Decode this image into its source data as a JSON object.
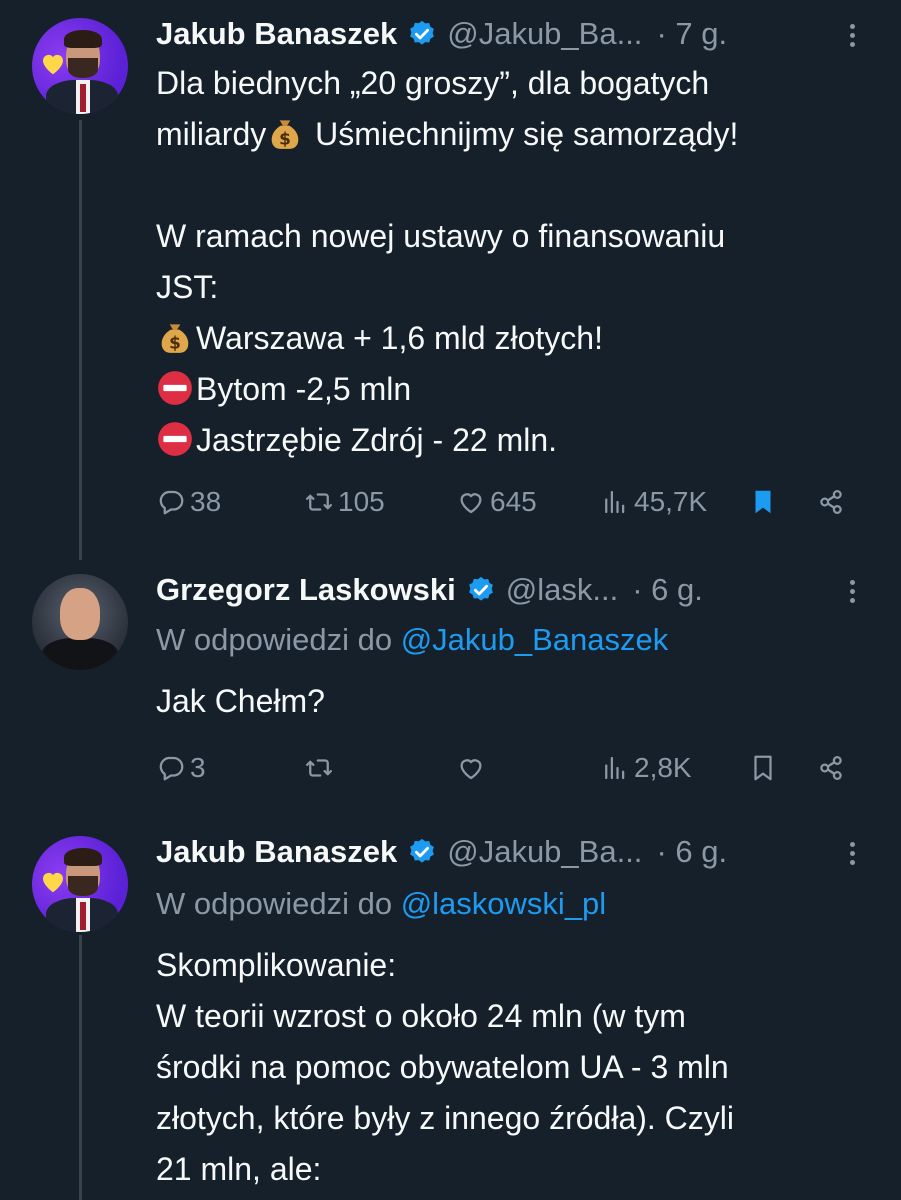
{
  "tweets": [
    {
      "author": "Jakub Banaszek",
      "handle": "@Jakub_Ba...",
      "time": "· 7 g.",
      "lines": [
        "Dla biednych „20 groszy”, dla bogatych",
        "miliardy",
        " Uśmiechnijmy się samorządy!",
        "",
        "W ramach nowej ustawy o finansowaniu",
        "JST:",
        "Warszawa + 1,6 mld złotych!",
        "Bytom -2,5 mln",
        "Jastrzębie Zdrój - 22 mln."
      ],
      "emoji": [
        "money-bag",
        "money-bag",
        "no-entry",
        "no-entry"
      ],
      "stats": {
        "replies": "38",
        "retweets": "105",
        "likes": "645",
        "views": "45,7K"
      },
      "bookmarked": true,
      "accent": "#1d9bf0"
    },
    {
      "author": "Grzegorz Laskowski",
      "handle": "@lask...",
      "time": "· 6 g.",
      "reply_prefix": "W odpowiedzi do",
      "reply_to": "@Jakub_Banaszek",
      "lines": [
        "Jak Chełm?"
      ],
      "stats": {
        "replies": "3",
        "retweets": "",
        "likes": "",
        "views": "2,8K"
      },
      "bookmarked": false
    },
    {
      "author": "Jakub Banaszek",
      "handle": "@Jakub_Ba...",
      "time": "· 6 g.",
      "reply_prefix": "W odpowiedzi do",
      "reply_to": "@laskowski_pl",
      "lines": [
        "Skomplikowanie:",
        "W teorii wzrost o około 24 mln (w tym",
        "środki na pomoc obywatelom UA - 3 mln",
        "złotych, które były z innego źródła). Czyli",
        "21 mln, ale:"
      ]
    }
  ],
  "colors": {
    "background": "#15202b",
    "text": "#f7f9f9",
    "muted": "#8b98a5",
    "link": "#1d9bf0"
  },
  "icons": [
    "verified-badge-icon",
    "more-icon",
    "reply-icon",
    "retweet-icon",
    "like-icon",
    "views-icon",
    "bookmark-icon",
    "share-icon"
  ]
}
